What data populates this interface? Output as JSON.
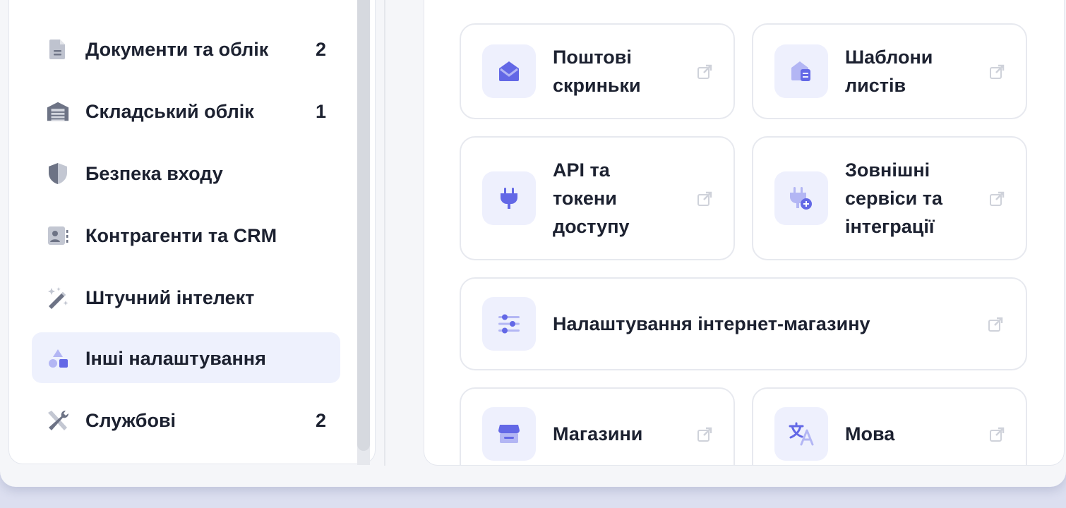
{
  "sidebar": {
    "items": [
      {
        "label": "Документи та облік",
        "count": "2",
        "icon": "document-icon"
      },
      {
        "label": "Складський облік",
        "count": "1",
        "icon": "warehouse-icon"
      },
      {
        "label": "Безпека входу",
        "count": "",
        "icon": "shield-icon"
      },
      {
        "label": "Контрагенти та CRM",
        "count": "",
        "icon": "contact-card-icon"
      },
      {
        "label": "Штучний інтелект",
        "count": "",
        "icon": "magic-wand-icon"
      },
      {
        "label": "Інші налаштування",
        "count": "",
        "icon": "shapes-icon",
        "active": true
      },
      {
        "label": "Службові",
        "count": "2",
        "icon": "tools-icon"
      }
    ]
  },
  "cards": {
    "mailboxes": {
      "line1": "Поштові",
      "line2": "скриньки",
      "icon": "envelope-icon"
    },
    "templates": {
      "line1": "Шаблони",
      "line2": "листів",
      "icon": "mail-template-icon"
    },
    "api": {
      "line1": "API та",
      "line2": "токени",
      "line3": "доступу",
      "icon": "plug-icon"
    },
    "integrations": {
      "line1": "Зовнішні",
      "line2": "сервіси та",
      "line3": "інтеграції",
      "icon": "plug-add-icon"
    },
    "shop_settings": {
      "label": "Налаштування інтернет-магазину",
      "icon": "sliders-icon"
    },
    "stores": {
      "label": "Магазини",
      "icon": "storefront-icon"
    },
    "language": {
      "label": "Мова",
      "icon": "translate-icon"
    }
  },
  "colors": {
    "accent": "#6368e6",
    "accent_light": "#b3b6f4",
    "icon_bg": "#eef0fd",
    "sidebar_icon": "#7b8196",
    "active_bg": "#eef1fd"
  }
}
